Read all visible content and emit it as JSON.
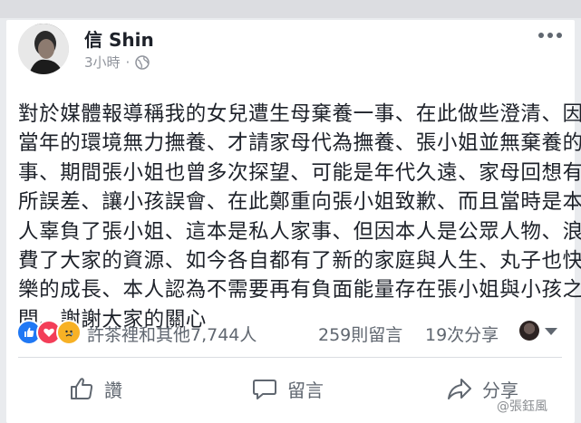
{
  "post": {
    "author": "信 Shin",
    "time": "3小時",
    "separator": "·",
    "lines": [
      "對於媒體報導稱我的女兒遭生母棄養一事、在此做些澄清、因",
      "當年的環境無力撫養、才請家母代為撫養、張小姐並無棄養的",
      "事、期間張小姐也曾多次探望、可能是年代久遠、家母回想有",
      "所誤差、讓小孩誤會、在此鄭重向張小姐致歉、而且當時是本",
      "人辜負了張小姐、這本是私人家事、但因本人是公眾人物、浪",
      "費了大家的資源、如今各自都有了新的家庭與人生、丸子也快",
      "樂的成長、本人認為不需要再有負面能量存在張小姐與小孩之",
      "間、謝謝大家的關心"
    ]
  },
  "stats": {
    "reactions_text": "許茶裡和其他7,744人",
    "comments_text": "259則留言",
    "shares_text": "19次分享"
  },
  "actions": {
    "like": "讚",
    "comment": "留言",
    "share": "分享"
  },
  "watermark": "@張鈺風",
  "colors": {
    "like_blue": "#2078f4",
    "love_red": "#f33e58",
    "sad_yellow": "#f7b125"
  }
}
